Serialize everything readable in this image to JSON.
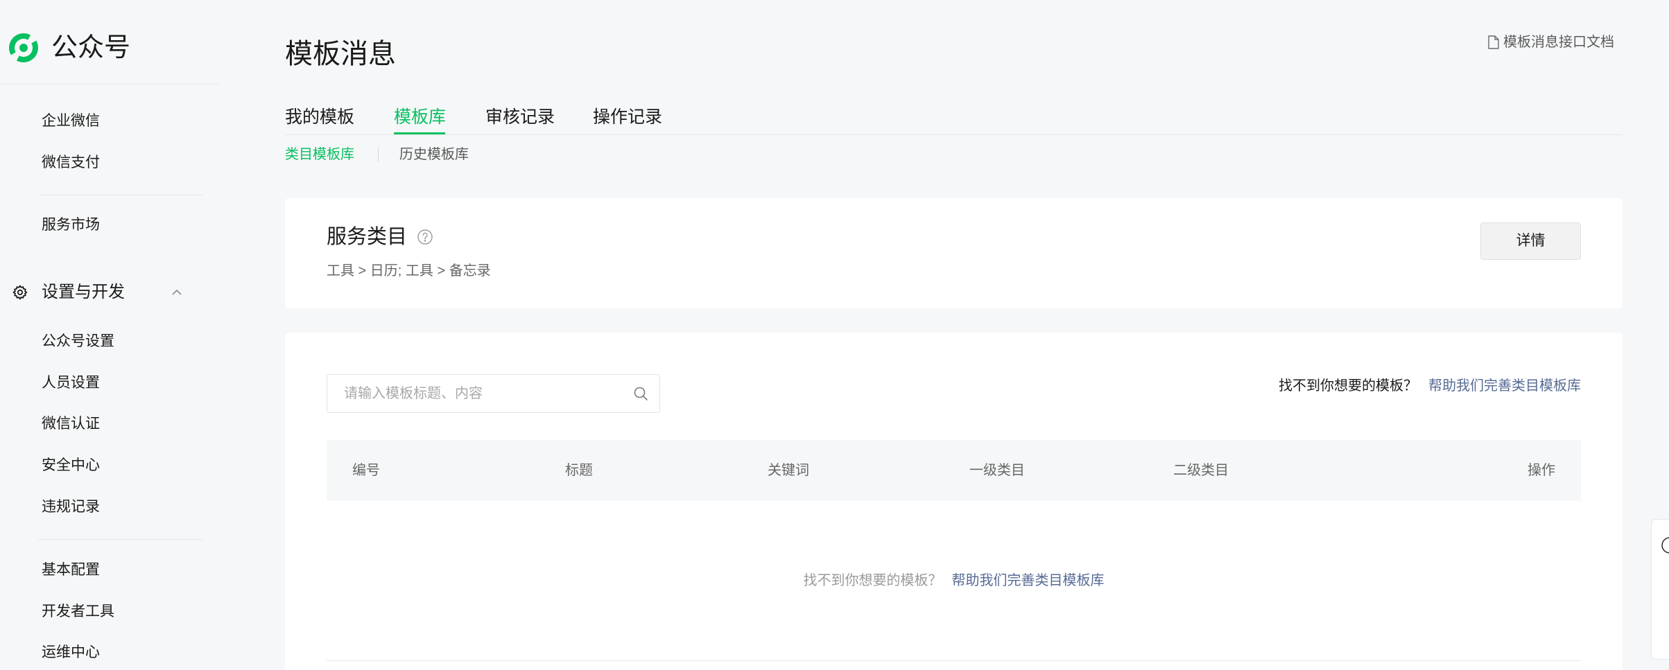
{
  "brand": {
    "name": "公众号",
    "logo_icon": "wechat-official-account-logo",
    "accent": "#07c160"
  },
  "sidebar": {
    "items_a": [
      {
        "label": "企业微信"
      },
      {
        "label": "微信支付"
      }
    ],
    "items_b": [
      {
        "label": "服务市场"
      }
    ],
    "section": {
      "label": "设置与开发",
      "icon": "gear-icon",
      "expanded": true
    },
    "items_c": [
      {
        "label": "公众号设置"
      },
      {
        "label": "人员设置"
      },
      {
        "label": "微信认证"
      },
      {
        "label": "安全中心"
      },
      {
        "label": "违规记录"
      }
    ],
    "items_d": [
      {
        "label": "基本配置"
      },
      {
        "label": "开发者工具"
      },
      {
        "label": "运维中心"
      }
    ]
  },
  "header": {
    "title": "模板消息",
    "doc_link": "模板消息接口文档",
    "doc_icon": "document-icon"
  },
  "tabs": [
    {
      "label": "我的模板",
      "active": false
    },
    {
      "label": "模板库",
      "active": true
    },
    {
      "label": "审核记录",
      "active": false
    },
    {
      "label": "操作记录",
      "active": false
    }
  ],
  "subtabs": [
    {
      "label": "类目模板库",
      "active": true
    },
    {
      "label": "历史模板库",
      "active": false
    }
  ],
  "category_card": {
    "title": "服务类目",
    "help_icon": "question-circle-icon",
    "categories": "工具 > 日历; 工具 > 备忘录",
    "details_button": "详情"
  },
  "search": {
    "placeholder": "请输入模板标题、内容",
    "value": "",
    "icon": "search-icon"
  },
  "help_prompt": {
    "question": "找不到你想要的模板？",
    "link": "帮助我们完善类目模板库"
  },
  "table": {
    "columns": [
      "编号",
      "标题",
      "关键词",
      "一级类目",
      "二级类目",
      "操作"
    ],
    "rows": [],
    "empty": {
      "question": "找不到你想要的模板？",
      "link": "帮助我们完善类目模板库"
    }
  },
  "colors": {
    "accent": "#07c160",
    "link": "#576b95",
    "text": "#1a1a1a",
    "muted": "#666666",
    "page_bg": "#f6f7f8",
    "card_bg": "#ffffff"
  }
}
